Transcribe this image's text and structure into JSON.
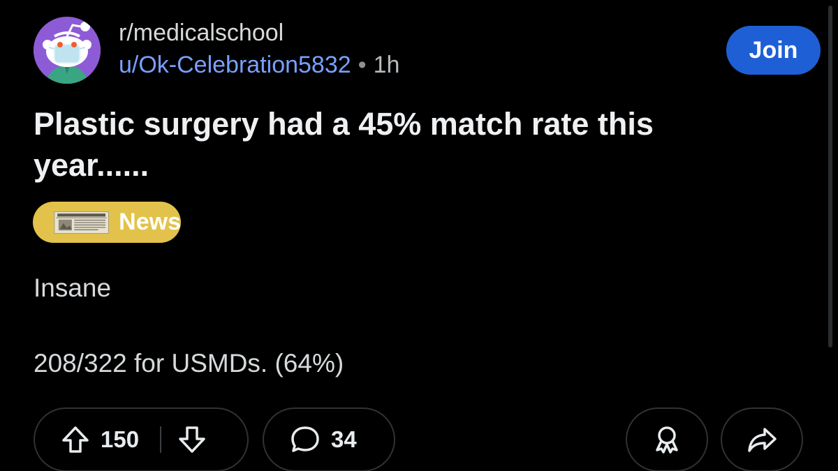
{
  "subreddit": {
    "name": "r/medicalschool",
    "icon": "reddit-nurse-avatar-icon"
  },
  "author": {
    "username": "u/Ok-Celebration5832",
    "separator": "•",
    "time": "1h"
  },
  "join_button": {
    "label": "Join"
  },
  "post": {
    "title": "Plastic surgery had a 45% match rate this year......",
    "flair": {
      "label": "News",
      "icon": "newspaper-icon",
      "color": "#e2c24a"
    },
    "body": [
      "Insane",
      "208/322 for USMDs. (64%)"
    ]
  },
  "actions": {
    "upvotes": "150",
    "comments": "34",
    "upvote_icon": "upvote-arrow-icon",
    "downvote_icon": "downvote-arrow-icon",
    "comment_icon": "comment-bubble-icon",
    "award_icon": "award-icon",
    "share_icon": "share-arrow-icon"
  },
  "colors": {
    "background": "#000000",
    "accent": "#1f5fd6",
    "username": "#7aa0ff"
  }
}
